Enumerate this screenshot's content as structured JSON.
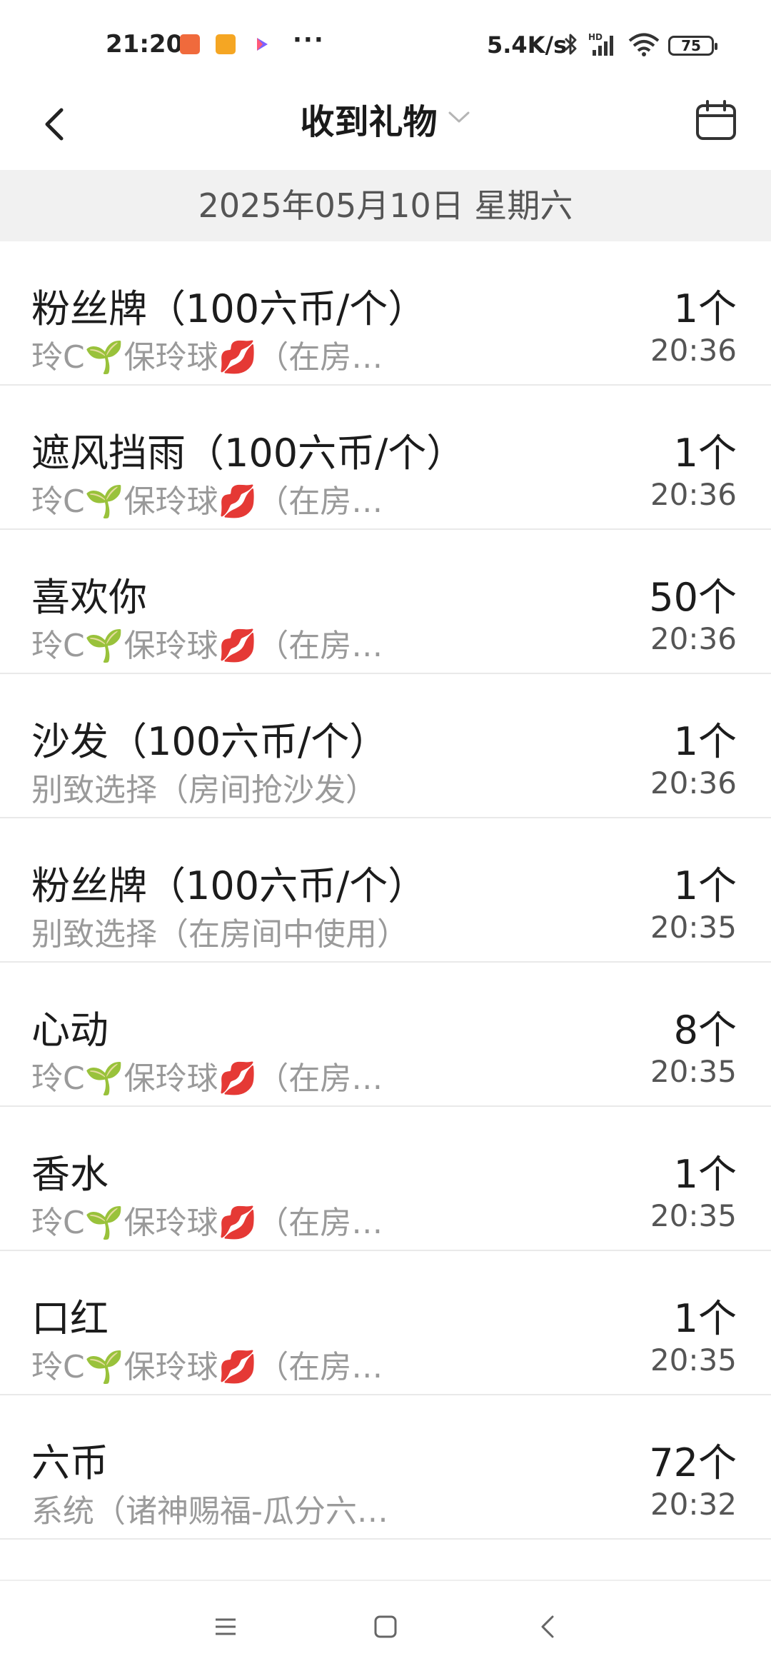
{
  "status_bar": {
    "time": "21:20",
    "more": "···",
    "net_speed": "5.4K/s",
    "battery": "75",
    "icons": [
      "shop-notification-icon",
      "smile-notification-icon",
      "play-notification-icon",
      "bluetooth-icon",
      "hd-signal-icon",
      "wifi-icon",
      "battery-icon"
    ]
  },
  "header": {
    "title": "收到礼物",
    "back_icon": "back-arrow-icon",
    "dropdown_icon": "chevron-down-icon",
    "calendar_icon": "calendar-icon"
  },
  "date_header": "2025年05月10日 星期六",
  "gifts": [
    {
      "name": "粉丝牌（100六币/个）",
      "sender": "玲C🌱保玲球💋（在房…",
      "count": "1个",
      "time": "20:36"
    },
    {
      "name": "遮风挡雨（100六币/个）",
      "sender": "玲C🌱保玲球💋（在房…",
      "count": "1个",
      "time": "20:36"
    },
    {
      "name": "喜欢你",
      "sender": "玲C🌱保玲球💋（在房…",
      "count": "50个",
      "time": "20:36"
    },
    {
      "name": "沙发（100六币/个）",
      "sender": "别致选择（房间抢沙发）",
      "count": "1个",
      "time": "20:36"
    },
    {
      "name": "粉丝牌（100六币/个）",
      "sender": "别致选择（在房间中使用）",
      "count": "1个",
      "time": "20:35"
    },
    {
      "name": "心动",
      "sender": "玲C🌱保玲球💋（在房…",
      "count": "8个",
      "time": "20:35"
    },
    {
      "name": "香水",
      "sender": "玲C🌱保玲球💋（在房…",
      "count": "1个",
      "time": "20:35"
    },
    {
      "name": "口红",
      "sender": "玲C🌱保玲球💋（在房…",
      "count": "1个",
      "time": "20:35"
    },
    {
      "name": "六币",
      "sender": "系统（诸神赐福-瓜分六…",
      "count": "72个",
      "time": "20:32"
    }
  ],
  "nav_bar": {
    "icons": [
      "menu-icon",
      "home-square-icon",
      "back-triangle-icon"
    ]
  },
  "colors": {
    "date_header_bg": "#f1f1f1",
    "secondary_text": "#9a9a9a",
    "primary_text": "#1c1c1c"
  }
}
